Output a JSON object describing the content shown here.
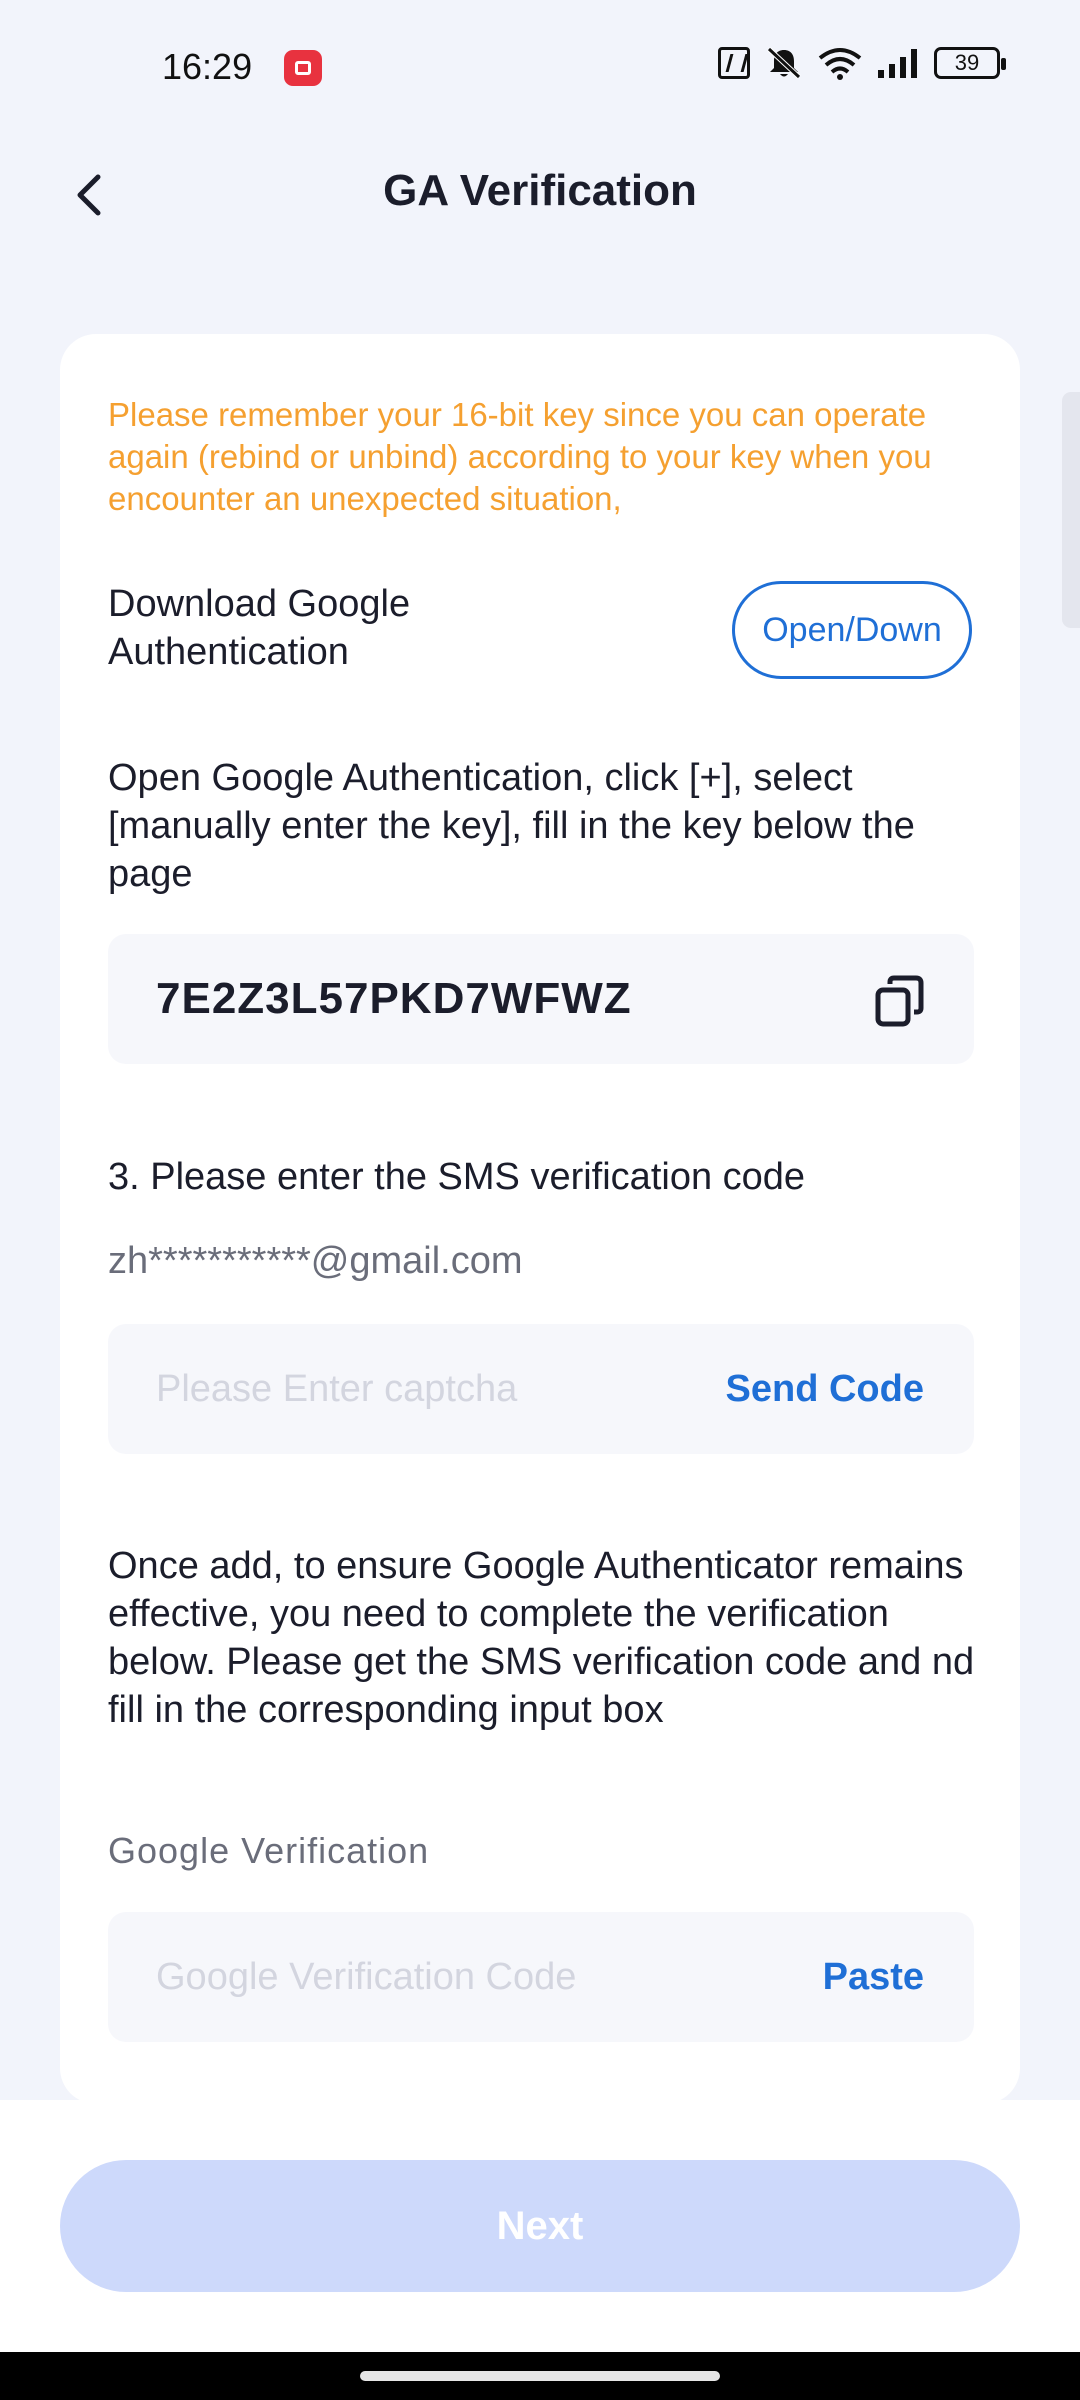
{
  "status_bar": {
    "time": "16:29",
    "battery": "39",
    "icons": [
      "screen-record-icon",
      "nfc-icon",
      "mute-icon",
      "wifi-icon",
      "signal-icon",
      "battery-icon"
    ]
  },
  "header": {
    "title": "GA Verification",
    "back_icon": "chevron-left-icon"
  },
  "card": {
    "warning": "Please remember your 16-bit key since you can operate again (rebind or unbind) according to your key when you encounter an unexpected situation,",
    "download_label": "Download Google Authentication",
    "open_down_label": "Open/Down",
    "instructions": "Open Google Authentication, click [+], select [manually enter the key], fill in the key below the page",
    "key": "7E2Z3L57PKD7WFWZ",
    "copy_icon": "copy-icon",
    "sms_title": "3. Please enter the SMS verification code",
    "email": "zh***********@gmail.com",
    "captcha_placeholder": "Please Enter captcha",
    "captcha_value": "",
    "send_code_label": "Send Code",
    "note": "Once add, to ensure Google Authenticator remains effective, you need to complete the verification below. Please get the SMS verification code and nd fill in the corresponding input box",
    "ga_label": "Google Verification",
    "ga_placeholder": "Google Verification Code",
    "ga_value": "",
    "paste_label": "Paste"
  },
  "footer": {
    "next_label": "Next"
  },
  "colors": {
    "accent": "#1f6fd6",
    "warning": "#f5a030",
    "button_disabled": "#cdd9fb",
    "background": "#f2f4fb"
  }
}
